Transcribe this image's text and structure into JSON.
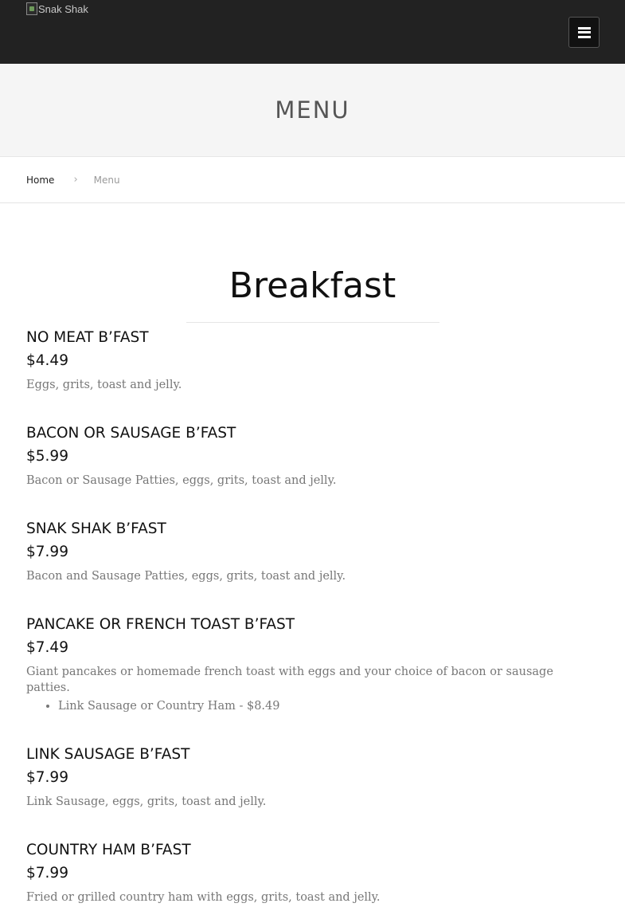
{
  "header": {
    "logo_alt": "Snak Shak",
    "menu_toggle_icon": "hamburger-icon"
  },
  "page": {
    "title": "MENU"
  },
  "breadcrumb": {
    "home": "Home",
    "separator": "›",
    "current": "Menu"
  },
  "section": {
    "title": "Breakfast"
  },
  "items": [
    {
      "name": "NO MEAT B’FAST",
      "price": "$4.49",
      "desc": "Eggs, grits, toast and jelly."
    },
    {
      "name": "BACON OR SAUSAGE B’FAST",
      "price": "$5.99",
      "desc": "Bacon or Sausage Patties, eggs, grits, toast and jelly."
    },
    {
      "name": "SNAK SHAK B’FAST",
      "price": "$7.99",
      "desc": "Bacon and Sausage Patties, eggs, grits, toast and jelly."
    },
    {
      "name": "PANCAKE OR FRENCH TOAST B’FAST",
      "price": "$7.49",
      "desc": "Giant pancakes or homemade french toast with eggs and your choice of bacon or sausage patties.",
      "options": [
        "Link Sausage or Country Ham - $8.49"
      ]
    },
    {
      "name": "LINK SAUSAGE B’FAST",
      "price": "$7.99",
      "desc": "Link Sausage, eggs, grits, toast and jelly."
    },
    {
      "name": "COUNTRY HAM B’FAST",
      "price": "$7.99",
      "desc": "Fried or grilled country ham with eggs, grits, toast and jelly."
    }
  ],
  "colors": {
    "topbar": "#222222",
    "title_band": "#f5f5f5",
    "desc_text": "#777777"
  }
}
